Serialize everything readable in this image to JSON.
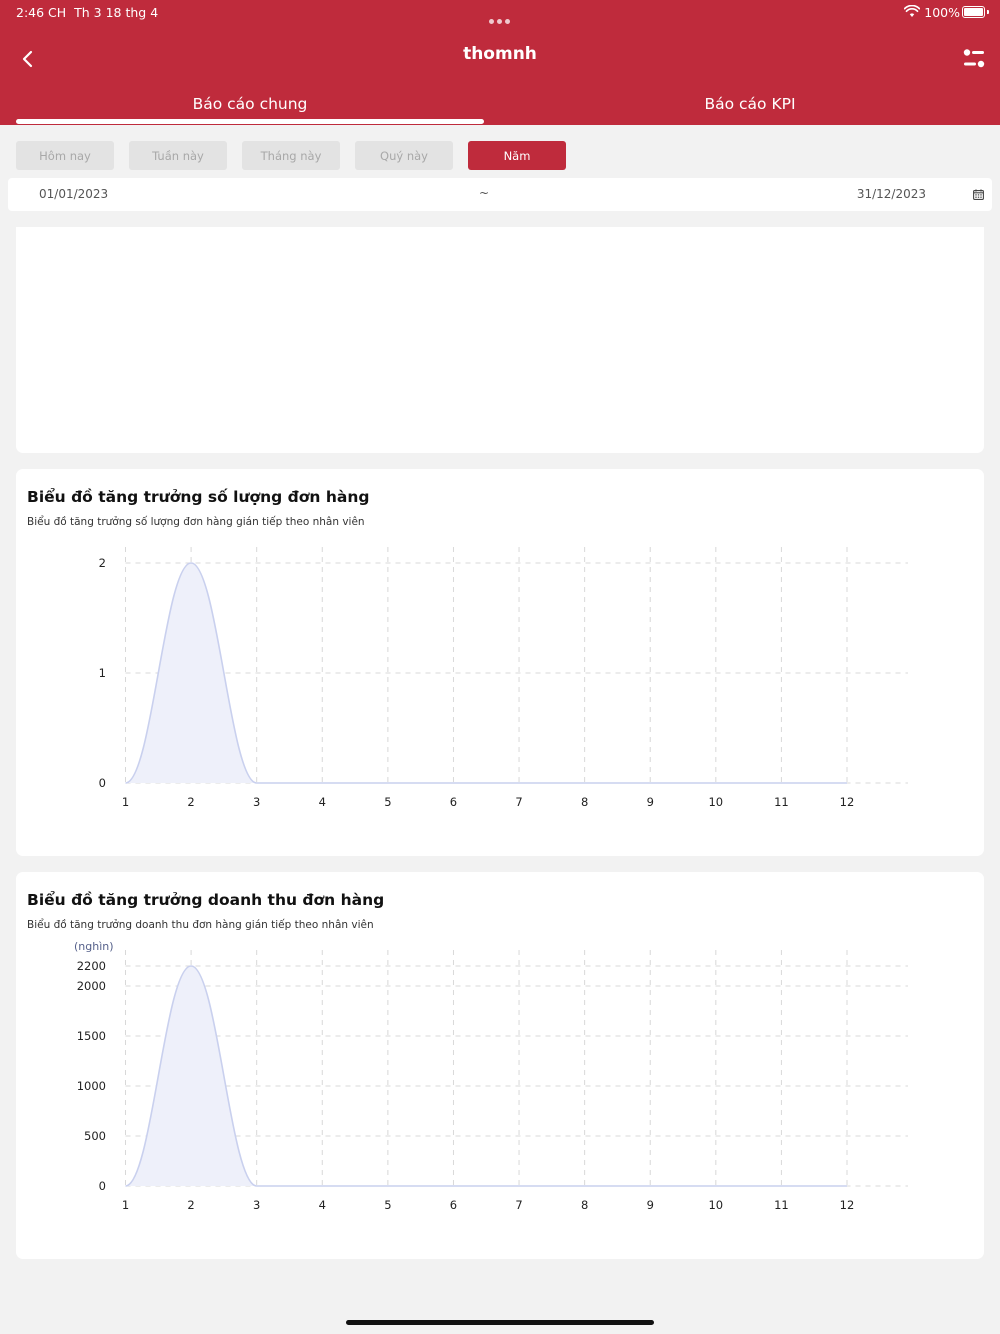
{
  "status_bar": {
    "time": "2:46 CH",
    "date": "Th 3 18 thg 4",
    "battery": "100%"
  },
  "header": {
    "title": "thomnh",
    "tabs": [
      {
        "label": "Báo cáo chung",
        "active": true
      },
      {
        "label": "Báo cáo KPI",
        "active": false
      }
    ]
  },
  "periods": [
    {
      "label": "Hôm nay",
      "active": false
    },
    {
      "label": "Tuần này",
      "active": false
    },
    {
      "label": "Tháng này",
      "active": false
    },
    {
      "label": "Quý này",
      "active": false
    },
    {
      "label": "Năm",
      "active": true
    }
  ],
  "date_range": {
    "from": "01/01/2023",
    "separator": "~",
    "to": "31/12/2023"
  },
  "colors": {
    "brand": "#bf2b3c",
    "line": "#c9d0ee",
    "area": "#eef0fa",
    "grid": "#d8d8d8"
  },
  "chart_data": [
    {
      "type": "area",
      "title": "Biểu đồ tăng trưởng số lượng đơn hàng",
      "subtitle": "Biểu đồ tăng trưởng số lượng đơn hàng gián tiếp theo nhân viên",
      "unit": "",
      "x": [
        1,
        2,
        3,
        4,
        5,
        6,
        7,
        8,
        9,
        10,
        11,
        12
      ],
      "values": [
        0,
        2,
        0,
        0,
        0,
        0,
        0,
        0,
        0,
        0,
        0,
        0
      ],
      "yticks": [
        0,
        1,
        2
      ],
      "ylim": [
        0,
        2
      ],
      "grid": true
    },
    {
      "type": "area",
      "title": "Biểu đồ tăng trưởng doanh thu đơn hàng",
      "subtitle": "Biểu đồ tăng trưởng doanh thu đơn hàng gián tiếp theo nhân viên",
      "unit": "(nghìn)",
      "x": [
        1,
        2,
        3,
        4,
        5,
        6,
        7,
        8,
        9,
        10,
        11,
        12
      ],
      "values": [
        0,
        2200,
        0,
        0,
        0,
        0,
        0,
        0,
        0,
        0,
        0,
        0
      ],
      "yticks": [
        0,
        500,
        1000,
        1500,
        2000,
        2200
      ],
      "ylim": [
        0,
        2200
      ],
      "grid": true
    }
  ]
}
